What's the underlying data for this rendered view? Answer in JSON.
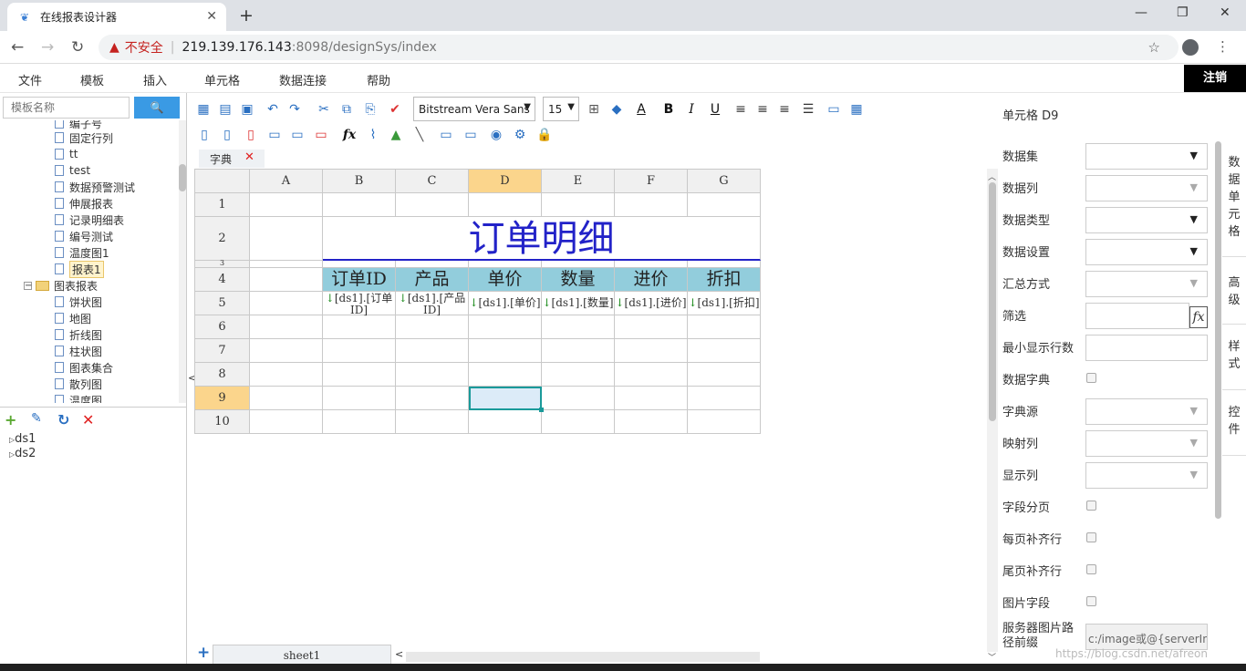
{
  "browser": {
    "tab_title": "在线报表设计器",
    "security_label": "不安全",
    "url_host": "219.139.176.143",
    "url_path": ":8098/designSys/index"
  },
  "menubar": {
    "items": [
      "文件",
      "模板",
      "插入",
      "单元格",
      "数据连接",
      "帮助"
    ],
    "logout": "注销"
  },
  "left": {
    "search_placeholder": "模板名称",
    "tree": [
      {
        "label": "编子号",
        "type": "file"
      },
      {
        "label": "固定行列",
        "type": "file"
      },
      {
        "label": "tt",
        "type": "file"
      },
      {
        "label": "test",
        "type": "file"
      },
      {
        "label": "数据预警测试",
        "type": "file"
      },
      {
        "label": "伸展报表",
        "type": "file"
      },
      {
        "label": "记录明细表",
        "type": "file"
      },
      {
        "label": "编号测试",
        "type": "file"
      },
      {
        "label": "温度图1",
        "type": "file"
      },
      {
        "label": "报表1",
        "type": "file",
        "selected": true
      },
      {
        "label": "图表报表",
        "type": "folder"
      },
      {
        "label": "饼状图",
        "type": "file"
      },
      {
        "label": "地图",
        "type": "file"
      },
      {
        "label": "折线图",
        "type": "file"
      },
      {
        "label": "柱状图",
        "type": "file"
      },
      {
        "label": "图表集合",
        "type": "file"
      },
      {
        "label": "散列图",
        "type": "file"
      },
      {
        "label": "温度图",
        "type": "file"
      }
    ],
    "datasets": [
      "ds1",
      "ds2"
    ]
  },
  "toolbar": {
    "font": "Bitstream Vera Sans",
    "size": "15"
  },
  "doc_tab": "字典",
  "grid": {
    "columns": [
      "A",
      "B",
      "C",
      "D",
      "E",
      "F",
      "G"
    ],
    "rows": [
      "1",
      "2",
      "3",
      "4",
      "5",
      "6",
      "7",
      "8",
      "9",
      "10"
    ],
    "active_col": "D",
    "active_row": "9",
    "title": "订单明细",
    "headers": [
      "订单ID",
      "产品",
      "单价",
      "数量",
      "进价",
      "折扣"
    ],
    "fields": [
      "[ds1].[订单ID]",
      "[ds1].[产品ID]",
      "[ds1].[单价]",
      "[ds1].[数量]",
      "[ds1].[进价]",
      "[ds1].[折扣]"
    ]
  },
  "sheet_tab": "sheet1",
  "right": {
    "cell_name": "单元格 D9",
    "labels": {
      "dataset": "数据集",
      "column": "数据列",
      "type": "数据类型",
      "setting": "数据设置",
      "summary": "汇总方式",
      "filter": "筛选",
      "min_rows": "最小显示行数",
      "dict": "数据字典",
      "dict_src": "字典源",
      "map_col": "映射列",
      "show_col": "显示列",
      "field_page": "字段分页",
      "pad_each": "每页补齐行",
      "pad_last": "尾页补齐行",
      "image_field": "图片字段",
      "server_path": "服务器图片路径前缀"
    },
    "server_path_value": "c:/image或@{serverIn",
    "side_tabs": [
      "数据单元格",
      "高级",
      "样式",
      "控件"
    ]
  },
  "watermark": "https://blog.csdn.net/afreon"
}
